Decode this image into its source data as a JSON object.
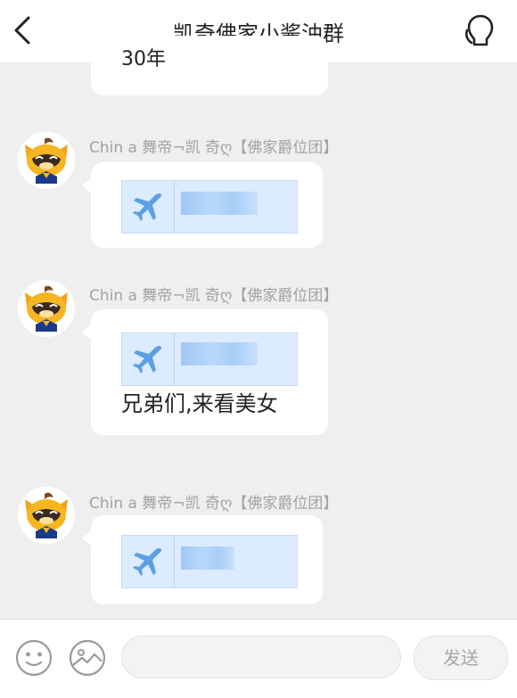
{
  "header": {
    "title": "凯奇佛家小酱油群",
    "back_icon": "back-arrow-icon",
    "member_icon": "group-members-icon"
  },
  "partial_message": {
    "text": "30年"
  },
  "messages": [
    {
      "sender": "Chin a 舞帝¬凯  奇ღ【佛家爵位团】",
      "card_icon": "airplane-icon"
    },
    {
      "sender": "Chin a 舞帝¬凯  奇ღ【佛家爵位团】",
      "card_icon": "airplane-icon",
      "text": "兄弟们,来看美女"
    },
    {
      "sender": "Chin a 舞帝¬凯  奇ღ【佛家爵位团】",
      "card_icon": "airplane-icon"
    }
  ],
  "footer": {
    "emoji_icon": "emoji-icon",
    "image_icon": "image-icon",
    "input_value": "",
    "input_placeholder": "",
    "send_label": "发送"
  },
  "colors": {
    "background": "#efefef",
    "card_bg": "#dcebff",
    "plane": "#5b9fe4",
    "sender_text": "#a2a2a2"
  }
}
